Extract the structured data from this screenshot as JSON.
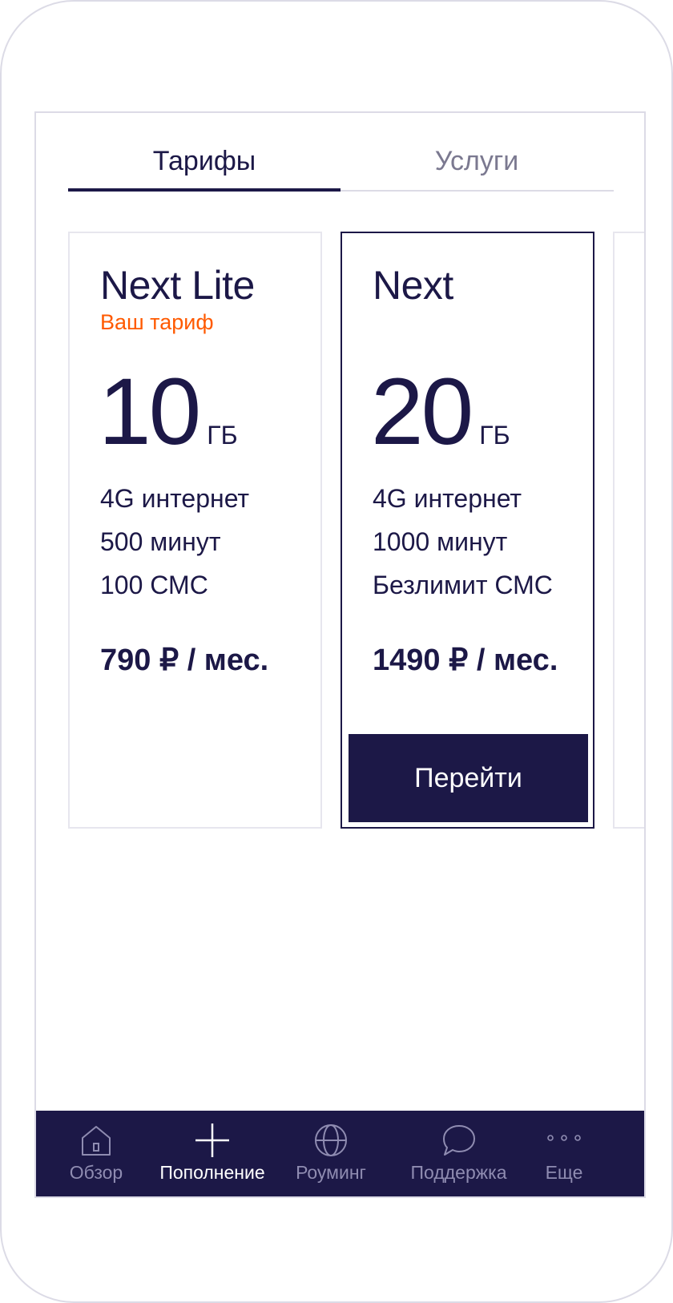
{
  "tabs": {
    "tariffs": "Тарифы",
    "services": "Услуги"
  },
  "cards": [
    {
      "name": "Next Lite",
      "badge": "Ваш тариф",
      "gb_value": "10",
      "gb_unit": "ГБ",
      "features": [
        "4G интернет",
        "500 минут",
        "100 СМС"
      ],
      "price": "790 ₽ / мес."
    },
    {
      "name": "Next",
      "gb_value": "20",
      "gb_unit": "ГБ",
      "features": [
        "4G интернет",
        "1000 минут",
        "Безлимит СМС"
      ],
      "price": "1490 ₽ / мес.",
      "button": "Перейти"
    }
  ],
  "bottom_nav": [
    {
      "label": "Обзор",
      "icon": "home-icon"
    },
    {
      "label": "Пополнение",
      "icon": "plus-icon"
    },
    {
      "label": "Роуминг",
      "icon": "globe-icon"
    },
    {
      "label": "Поддержка",
      "icon": "chat-bubble-icon"
    },
    {
      "label": "Еще",
      "icon": "more-dots-icon"
    }
  ],
  "colors": {
    "primary": "#1c1847",
    "accent": "#ff5a00",
    "inactive": "#7b7990",
    "nav_inactive": "#8f8cb1"
  }
}
